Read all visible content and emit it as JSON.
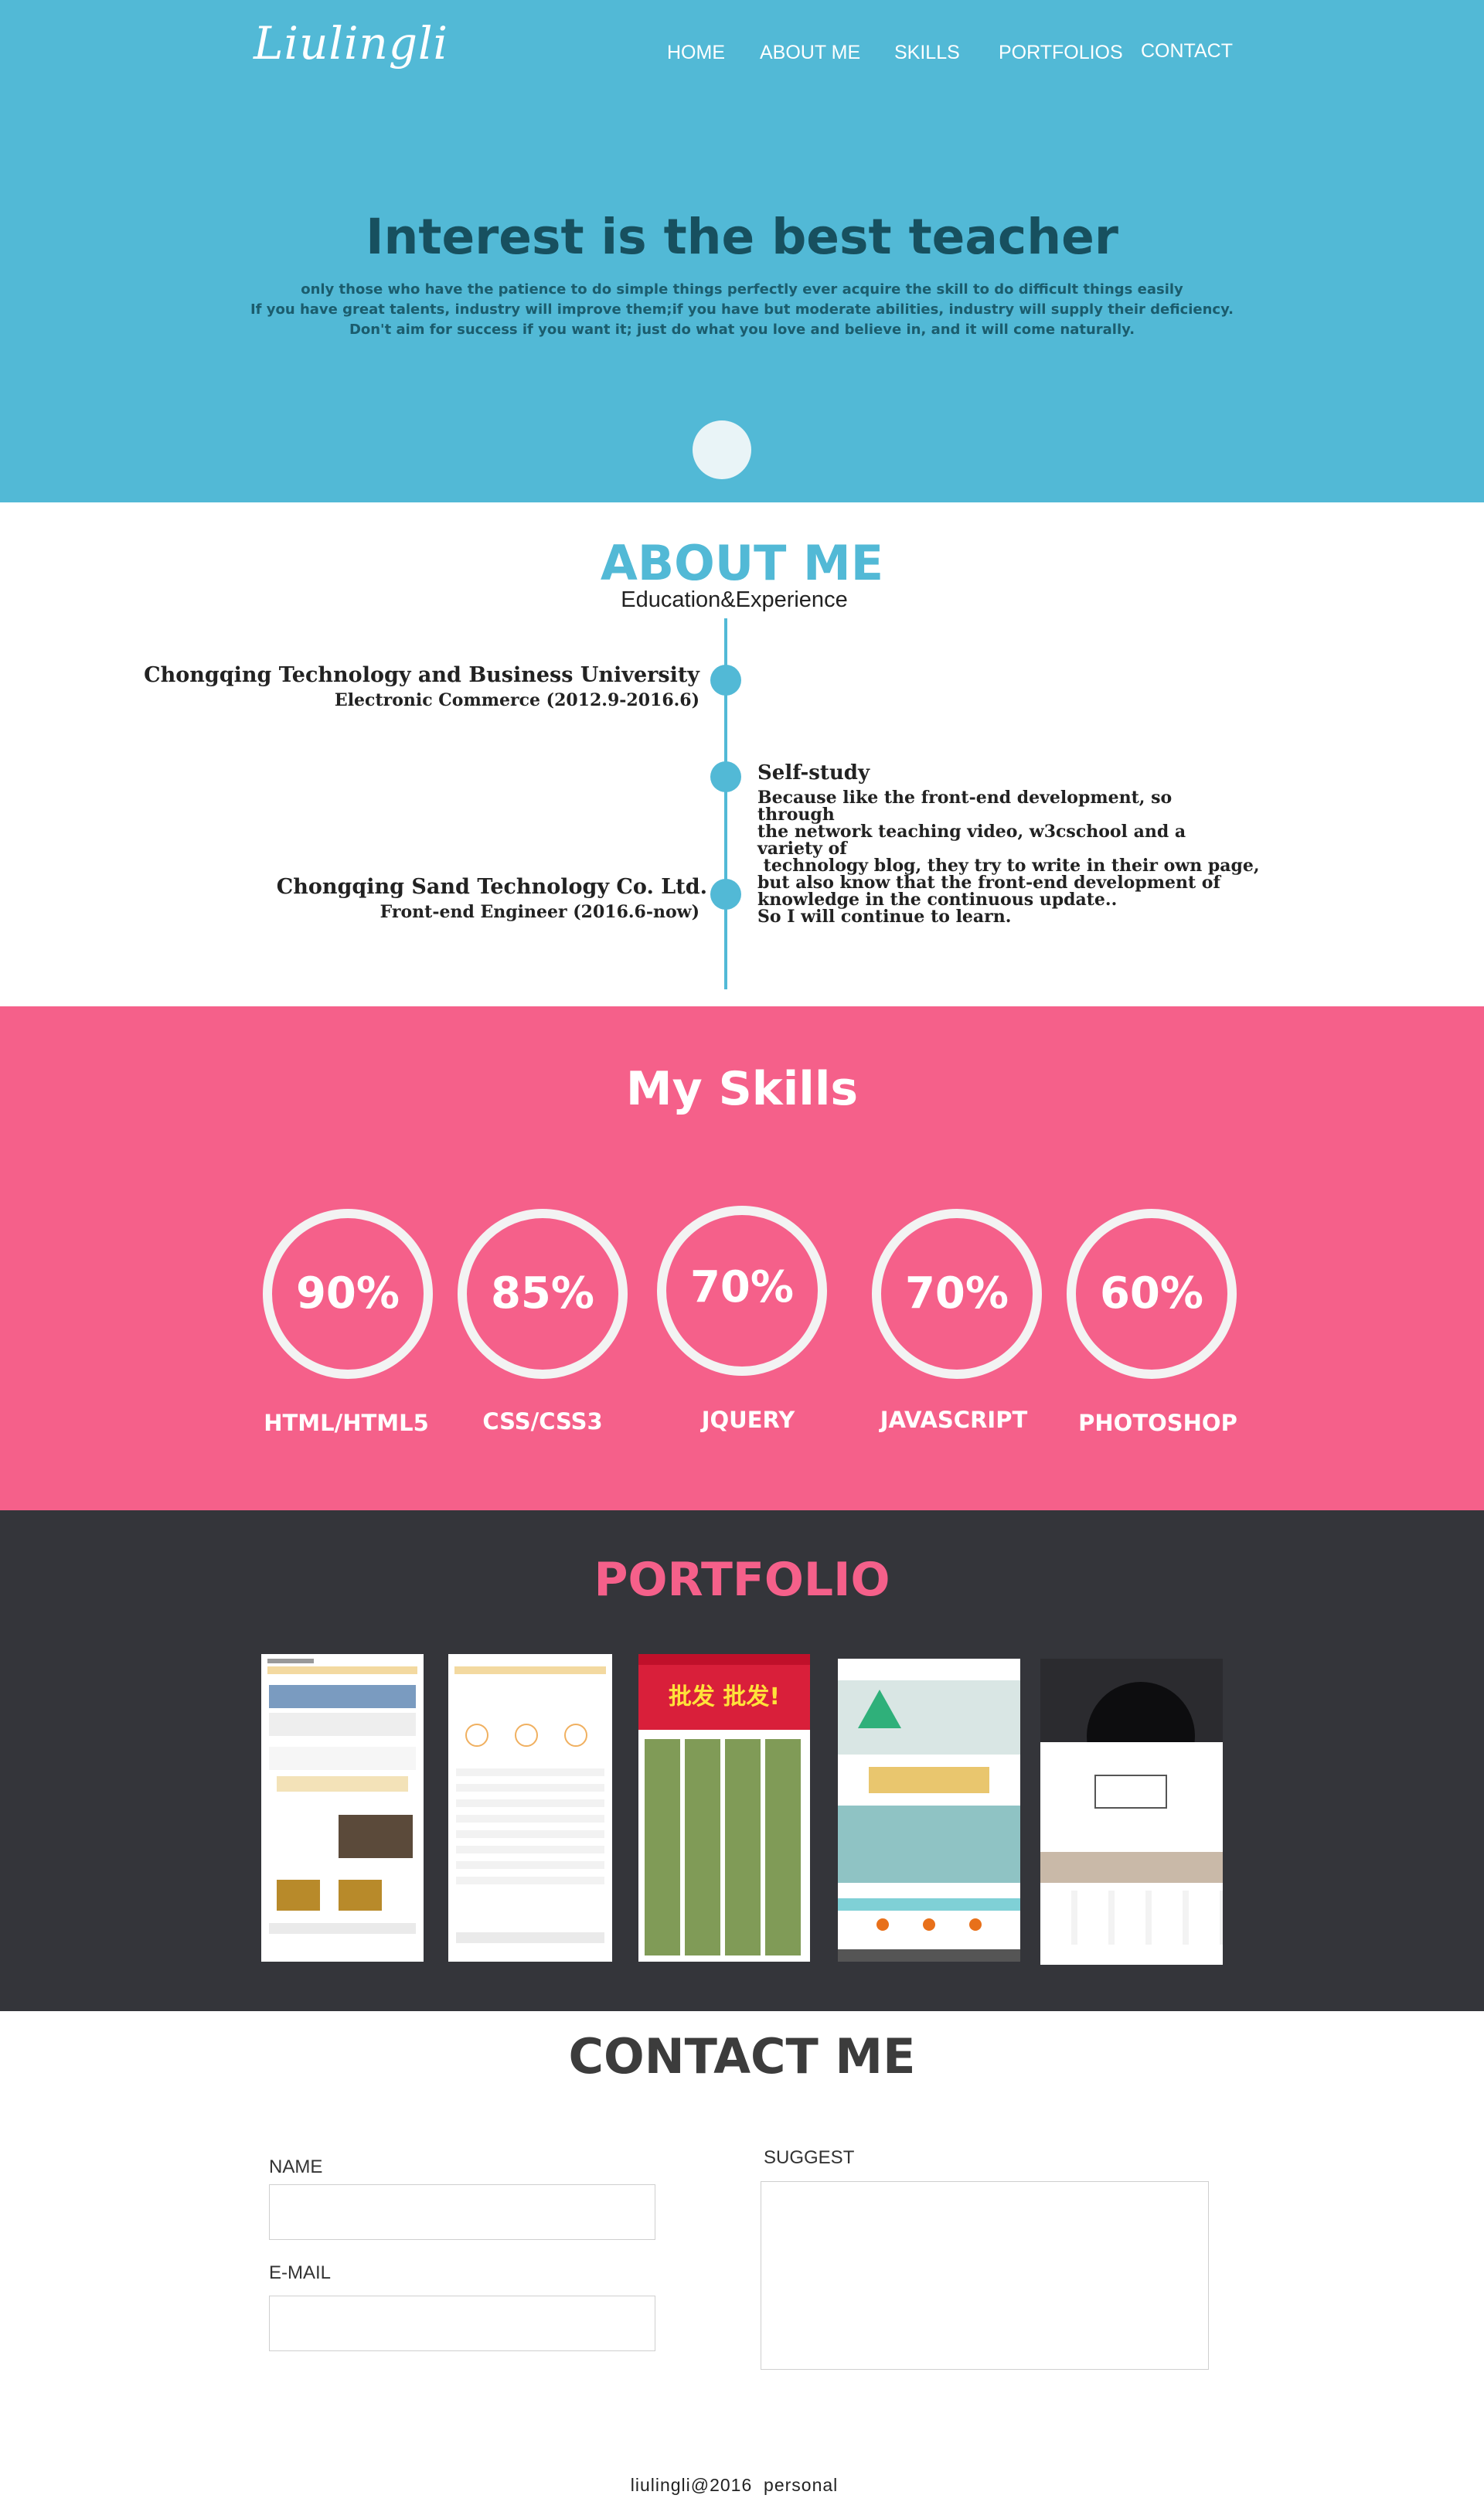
{
  "header": {
    "logo": "Liulingli",
    "nav": [
      {
        "label": "HOME"
      },
      {
        "label": "ABOUT ME"
      },
      {
        "label": "SKILLS"
      },
      {
        "label": "PORTFOLIOS"
      },
      {
        "label": "CONTACT"
      }
    ]
  },
  "hero": {
    "title": "Interest is the best teacher",
    "lines": [
      "only those who have the patience to do simple things perfectly ever acquire the skill to do difficult things easily",
      "If you have great talents, industry will improve them;if you have but moderate abilities, industry will supply their deficiency.",
      "Don't aim for success if you want it; just do what you love and believe in, and it will come naturally."
    ]
  },
  "about": {
    "title": "ABOUT ME",
    "subtitle": "Education&Experience",
    "education": {
      "line1": "Chongqing Technology and Business University",
      "line2": "Electronic Commerce   (2012.9-2016.6)"
    },
    "self": {
      "heading": "Self-study",
      "lines": [
        "Because like the front-end development, so through",
        "the network teaching video, w3cschool and a variety of",
        " technology blog, they try to write in their own page,",
        "but also know that the front-end development of",
        "knowledge in the continuous update..",
        "So I will continue to learn."
      ]
    },
    "work": {
      "line1": "Chongqing Sand Technology Co. Ltd.",
      "line2": "Front-end Engineer (2016.6-now)"
    }
  },
  "skills": {
    "title": "My Skills",
    "items": [
      {
        "percent": "90%",
        "label": "HTML/HTML5",
        "value": 90
      },
      {
        "percent": "85%",
        "label": "CSS/CSS3",
        "value": 85
      },
      {
        "percent": "70%",
        "label": "JQUERY",
        "value": 70
      },
      {
        "percent": "70%",
        "label": "JAVASCRIPT",
        "value": 70
      },
      {
        "percent": "60%",
        "label": "PHOTOSHOP",
        "value": 60
      }
    ]
  },
  "portfolio": {
    "title": "PORTFOLIO",
    "thumb3_banner": "批发 批发!"
  },
  "contact": {
    "title": "CONTACT ME",
    "name_label": "NAME",
    "name_value": "",
    "email_label": "E-MAIL",
    "email_value": "",
    "suggest_label": "SUGGEST",
    "suggest_value": ""
  },
  "footer": {
    "text": "liulingli@2016  personal"
  },
  "colors": {
    "hero": "#52b9d6",
    "skills": "#f5608a",
    "portfolio": "#34353a",
    "accent": "#52b9d6"
  }
}
